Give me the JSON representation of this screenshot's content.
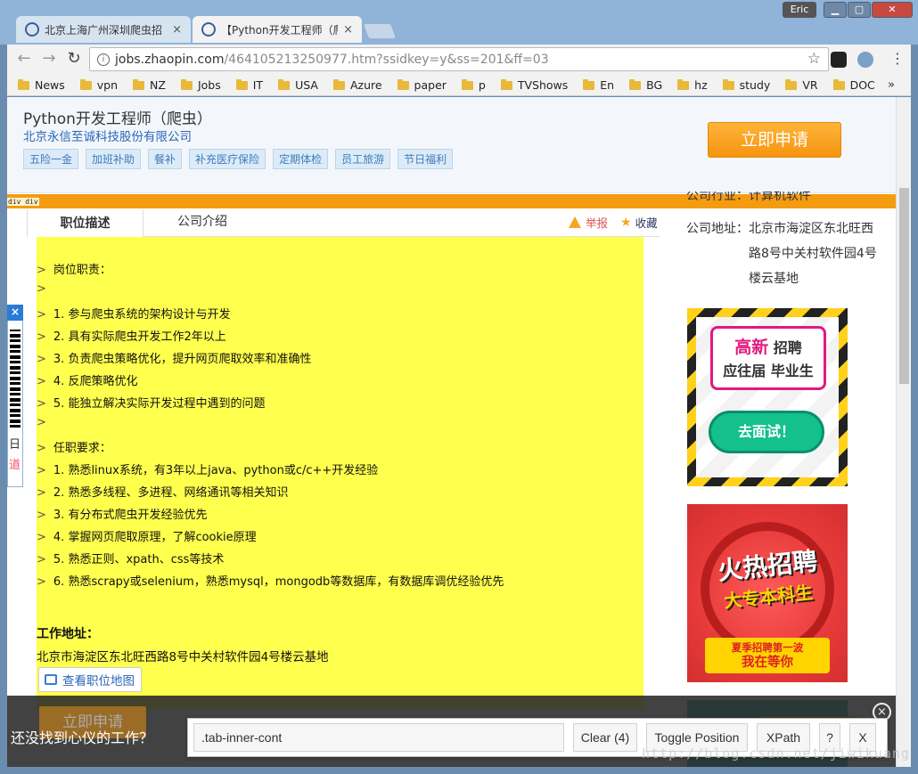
{
  "browser": {
    "tabs": [
      {
        "title": "北京上海广州深圳爬虫招",
        "close": "×"
      },
      {
        "title": "【Python开发工程师（爬",
        "close": "×"
      }
    ],
    "user": "Eric",
    "url_domain": "jobs.zhaopin.com",
    "url_path": "/464105213250977.htm?ssidkey=y&ss=201&ff=03",
    "bookmarks": [
      "News",
      "vpn",
      "NZ",
      "Jobs",
      "IT",
      "USA",
      "Azure",
      "paper",
      "p",
      "TVShows",
      "En",
      "BG",
      "hz",
      "study",
      "VR",
      "DOC"
    ],
    "bookmarks_more": "»"
  },
  "job": {
    "title": "Python开发工程师（爬虫）",
    "company": "北京永信至诚科技股份有限公司",
    "tags": [
      "五险一金",
      "加班补助",
      "餐补",
      "补充医疗保险",
      "定期体检",
      "员工旅游",
      "节日福利"
    ],
    "apply_label": "立即申请",
    "debug_label": "div div"
  },
  "content_tabs": {
    "description": "职位描述",
    "company_intro": "公司介绍",
    "report": "举报",
    "favorite": "收藏"
  },
  "description": {
    "lines": [
      "岗位职责：",
      "",
      "1. 参与爬虫系统的架构设计与开发",
      "2. 具有实际爬虫开发工作2年以上",
      "3. 负责爬虫策略优化，提升网页爬取效率和准确性",
      "4. 反爬策略优化",
      "5. 能独立解决实际开发过程中遇到的问题",
      "",
      "任职要求：",
      "1. 熟悉linux系统，有3年以上java、python或c/c++开发经验",
      "2. 熟悉多线程、多进程、网络通讯等相关知识",
      "3. 有分布式爬虫开发经验优先",
      "4. 掌握网页爬取原理，了解cookie原理",
      "5. 熟悉正则、xpath、css等技术",
      "6. 熟悉scrapy或selenium，熟悉mysql，mongodb等数据库，有数据库调优经验优先"
    ],
    "line_marker": ">",
    "address_heading": "工作地址：",
    "address": "北京市海淀区东北旺西路8号中关村软件园4号楼云基地",
    "map_label": "查看职位地图"
  },
  "sidebar": {
    "partial_line": "公司行业：计算机软件",
    "address_label": "公司地址：",
    "address_value": "北京市海淀区东北旺西路8号中关村软件园4号楼云基地",
    "ad1": {
      "hot": "高新",
      "line1": "招聘",
      "line2": "应往届 毕业生",
      "button": "去面试！"
    },
    "ad2": {
      "big": "火热招聘",
      "mid": "大专本科生",
      "ribbon1": "夏季招聘第一波",
      "ribbon2": "我在等你"
    }
  },
  "left_float": {
    "close": "×",
    "char1": "日",
    "char2": "道"
  },
  "bottom_bar": {
    "question": "还没找到心仪的工作？",
    "apply_ghost": "立即申请",
    "close": "×"
  },
  "selector_gadget": {
    "selector": ".tab-inner-cont",
    "clear": "Clear (4)",
    "toggle": "Toggle Position",
    "xpath": "XPath",
    "help": "?",
    "close": "X"
  },
  "watermark": "http://blog.csdn.net/jiwikuang"
}
